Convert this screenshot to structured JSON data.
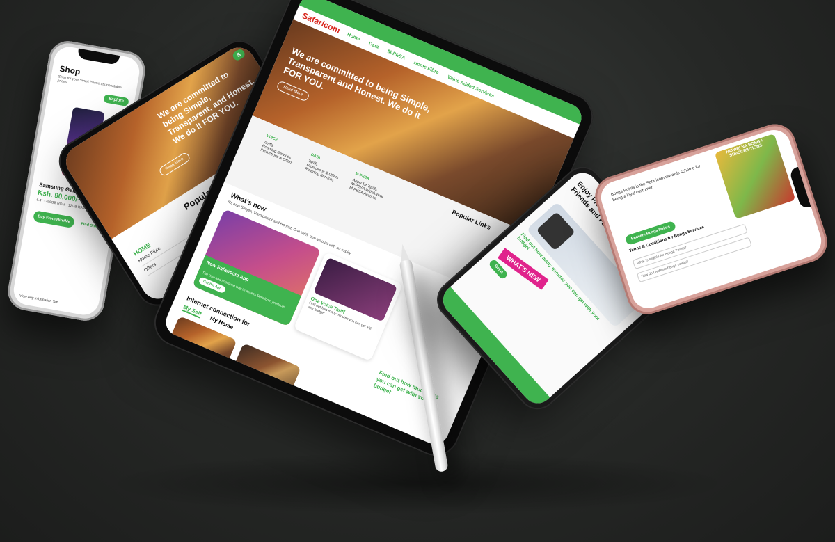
{
  "brand": {
    "logo": "Safaricom",
    "short_logo": "S",
    "accent": "#3fb34f",
    "brand_red": "#d9251c"
  },
  "tablet": {
    "menu": [
      "Home",
      "Data",
      "M-PESA",
      "Home Fibre",
      "Value Added Services"
    ],
    "hero_text": "We are committed to being Simple, Transparent and Honest. We do it FOR YOU.",
    "hero_button": "Read More",
    "popular_links_title": "Popular Links",
    "links_columns": [
      {
        "title": "VOICE",
        "items": [
          "Tariffs",
          "Roaming Services",
          "Promotions & Offers"
        ]
      },
      {
        "title": "DATA",
        "items": [
          "Tariffs",
          "Promotions & Offers",
          "Roaming Services"
        ]
      },
      {
        "title": "M-PESA",
        "items": [
          "Apply for Tariffs",
          "M-PESA Withdrawal",
          "M-PESA Account"
        ]
      }
    ],
    "whats_new_title": "What's new",
    "whats_new_sub": "It's new Simple, Transparent and Honest. One tariff, one amount with no expiry",
    "app_card_title": "New Safaricom App",
    "app_card_sub": "The new and improved way to access Safaricom products",
    "app_card_button": "Get the App",
    "offer_card_title": "One Voice Tariff",
    "offer_card_sub": "Find out how many minutes you can get with your budget",
    "internet_title": "Internet connection for",
    "tabs": [
      "My Self",
      "My Home"
    ],
    "budget_text": "Find out how much Data you can get with your budget"
  },
  "shop_phone": {
    "title": "Shop",
    "subtitle": "Shop for your Smart Phone at unbeatable prices",
    "explore_button": "Explore",
    "product_name": "Samsung Galaxy A",
    "price": "Ksh. 90,000/-",
    "specs": "6.4\" · 256GB ROM · 12GB RAM · 13MP",
    "buy_button": "Buy From Hire/Me",
    "find_button": "Find Store",
    "footer": "View Any Information Tab"
  },
  "links_phone": {
    "logo": "S",
    "hero_text": "We are committed to being Simple, Transparent, and Honest. We do it FOR YOU.",
    "hero_button": "Read More",
    "title": "Popular Links",
    "section": "HOME",
    "items": [
      "Home Fibre",
      "Offers"
    ]
  },
  "talk_phone": {
    "headline": "Enjoy Flexible Talk Time with Your Friends and Family",
    "question": "Find out how many minutes you can get with your budget",
    "badge": "WHAT'S NEW",
    "cta": "Get It"
  },
  "rose_phone": {
    "banner_title": "NAWIRI NA BONGA SUBSCRIPTIONS",
    "intro": "Bonga Points is the Safaricom rewards scheme for being a loyal customer",
    "button": "Redeem Bonga Points",
    "section": "Terms & Conditions for Bonga Services",
    "field_1": "What is eligible for Bonga Points?",
    "field_2": "How do I redeem bonga points?"
  }
}
